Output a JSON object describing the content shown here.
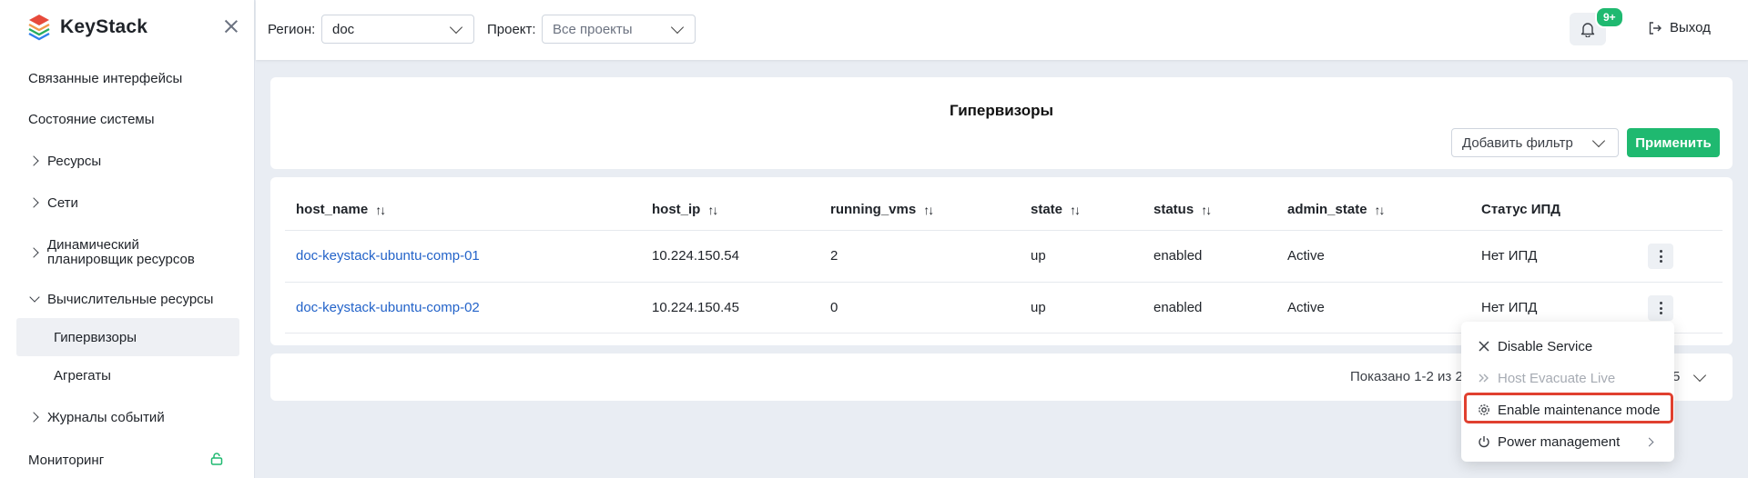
{
  "brand": {
    "name": "KeyStack"
  },
  "sidebar": {
    "items": [
      {
        "label": "Связанные интерфейсы"
      },
      {
        "label": "Состояние системы"
      },
      {
        "label": "Ресурсы"
      },
      {
        "label": "Сети"
      },
      {
        "label": "Динамический",
        "label2": "планировщик ресурсов"
      },
      {
        "label": "Вычислительные ресурсы"
      },
      {
        "label": "Журналы событий"
      },
      {
        "label": "Мониторинг"
      }
    ],
    "subitems": [
      {
        "label": "Гипервизоры",
        "active": true
      },
      {
        "label": "Агрегаты"
      }
    ]
  },
  "header": {
    "region_label": "Регион:",
    "region_value": "doc",
    "project_label": "Проект:",
    "project_value": "Все проекты",
    "notifications_badge": "9+",
    "logout_label": "Выход"
  },
  "page": {
    "title": "Гипервизоры",
    "filter_placeholder": "Добавить фильтр",
    "apply_label": "Применить"
  },
  "table": {
    "columns": [
      "host_name",
      "host_ip",
      "running_vms",
      "state",
      "status",
      "admin_state",
      "Статус ИПД"
    ],
    "rows": [
      {
        "host_name": "doc-keystack-ubuntu-comp-01",
        "host_ip": "10.224.150.54",
        "running_vms": "2",
        "state": "up",
        "status": "enabled",
        "admin_state": "Active",
        "ipd": "Нет ИПД"
      },
      {
        "host_name": "doc-keystack-ubuntu-comp-02",
        "host_ip": "10.224.150.45",
        "running_vms": "0",
        "state": "up",
        "status": "enabled",
        "admin_state": "Active",
        "ipd": "Нет ИПД"
      }
    ]
  },
  "pagination": {
    "summary": "Показано 1-2 из 2",
    "page_size": "5"
  },
  "context_menu": {
    "items": [
      {
        "label": "Disable Service",
        "icon": "close-icon"
      },
      {
        "label": "Host Evacuate Live",
        "icon": "double-chevron-right-icon",
        "disabled": true
      },
      {
        "label": "Enable maintenance mode",
        "icon": "gear-icon",
        "highlighted": true
      },
      {
        "label": "Power management",
        "icon": "power-icon",
        "submenu": true
      }
    ]
  },
  "colors": {
    "accent": "#1fb970",
    "link": "#2363c9",
    "highlight_border": "#e0402f"
  }
}
